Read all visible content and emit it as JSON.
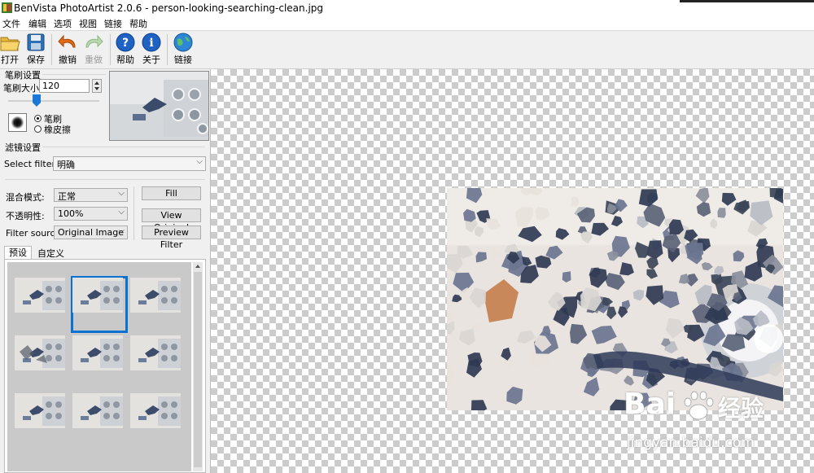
{
  "window": {
    "title": "BenVista PhotoArtist 2.0.6 - person-looking-searching-clean.jpg"
  },
  "menu": {
    "items": [
      "文件",
      "编辑",
      "选项",
      "视图",
      "链接",
      "帮助"
    ]
  },
  "toolbar": {
    "open": "打开",
    "save": "保存",
    "undo": "撤销",
    "redo": "重做",
    "help": "帮助",
    "about": "关于",
    "link": "链接"
  },
  "brush": {
    "group_title": "笔刷设置",
    "size_label": "笔刷大小:",
    "size_value": "120",
    "mode_brush": "笔刷",
    "mode_eraser": "橡皮擦"
  },
  "filter": {
    "group_title": "滤镜设置",
    "select_label": "Select filter:",
    "selected": "明确",
    "blend_label": "混合模式:",
    "blend_value": "正常",
    "opacity_label": "不透明性:",
    "opacity_value": "100%",
    "source_label": "Filter source:",
    "source_value": "Original Image",
    "fill_button": "Fill",
    "view_original_button": "View Original",
    "preview_button": "Preview Filter"
  },
  "presets": {
    "tabs": [
      "预设",
      "自定义"
    ],
    "count": 9,
    "selected_index": 1
  },
  "watermark": {
    "brand_latin": "Bai",
    "brand_cn": "经验",
    "url": "jingyan.baidu.com"
  },
  "colors": {
    "accent": "#0a72d1",
    "checker": "#cccccc"
  }
}
